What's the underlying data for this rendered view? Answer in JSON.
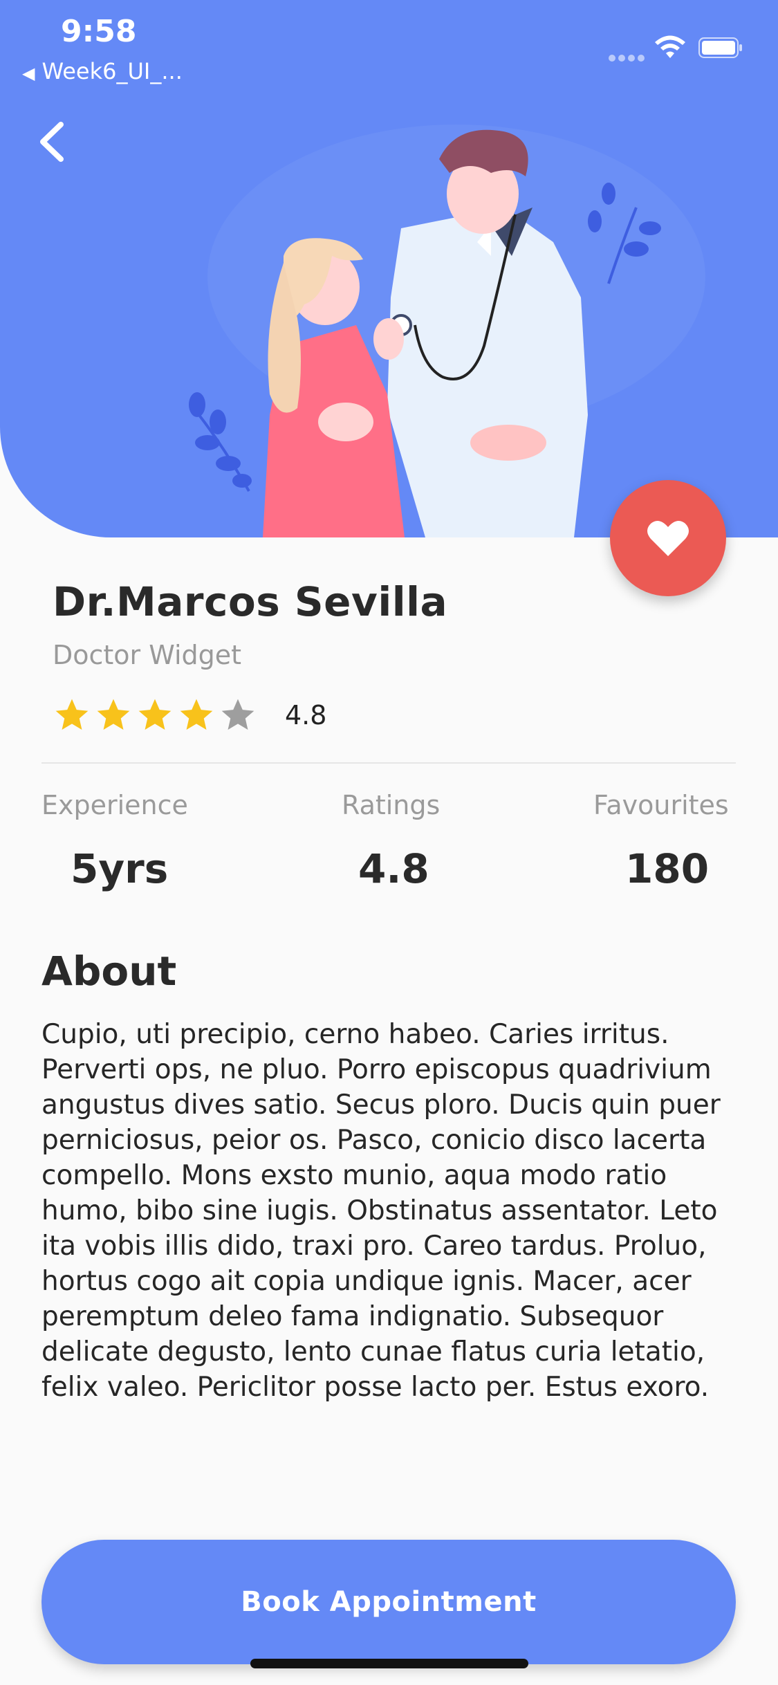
{
  "statusbar": {
    "time": "9:58",
    "back_app": "Week6_UI_...",
    "icons": [
      "cellular-icon",
      "wifi-icon",
      "battery-icon"
    ]
  },
  "header": {
    "back_icon": "chevron-left-icon",
    "favorite_icon": "heart-icon"
  },
  "doctor": {
    "name": "Dr.Marcos Sevilla",
    "role": "Doctor Widget",
    "rating": 4.8,
    "rating_label": "4.8",
    "stars_filled": 4,
    "stars_total": 5
  },
  "stats": [
    {
      "label": "Experience",
      "value": "5yrs"
    },
    {
      "label": "Ratings",
      "value": "4.8"
    },
    {
      "label": "Favourites",
      "value": "180"
    }
  ],
  "about": {
    "title": "About",
    "text": "Cupio, uti precipio, cerno habeo. Caries irritus. Perverti ops, ne pluo. Porro episcopus quadrivium angustus dives satio. Secus ploro. Ducis quin puer perniciosus, peior os. Pasco, conicio disco lacerta compello. Mons exsto munio, aqua modo ratio humo, bibo sine iugis. Obstinatus assentator. Leto ita vobis illis dido, traxi pro. Careo tardus. Proluo, hortus cogo ait copia undique ignis. Macer, acer peremptum deleo fama indignatio. Subsequor delicate degusto, lento cunae flatus curia letatio, felix valeo. Periclitor posse lacto per. Estus exoro."
  },
  "cta": {
    "label": "Book Appointment"
  },
  "colors": {
    "primary": "#6489f6",
    "favorite": "#eb5a54",
    "star_filled": "#f8c21b",
    "star_empty": "#9e9e9e"
  }
}
